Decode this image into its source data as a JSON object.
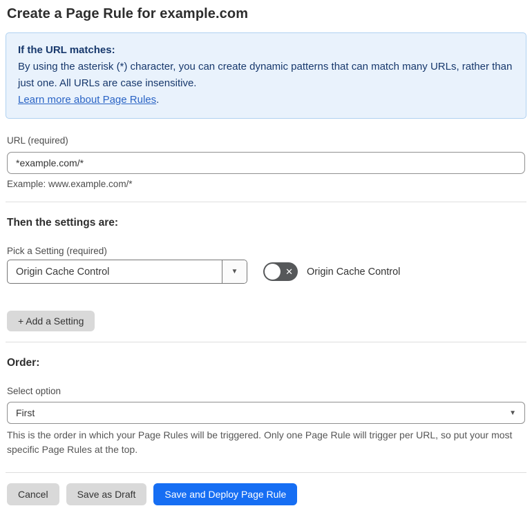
{
  "page": {
    "title": "Create a Page Rule for example.com"
  },
  "info_box": {
    "heading": "If the URL matches:",
    "body": "By using the asterisk (*) character, you can create dynamic patterns that can match many URLs, rather than just one. All URLs are case insensitive.",
    "link_text": "Learn more about Page Rules",
    "link_suffix": "."
  },
  "url_field": {
    "label": "URL (required)",
    "value": "*example.com/*",
    "helper": "Example: www.example.com/*"
  },
  "settings": {
    "heading": "Then the settings are:",
    "pick_label": "Pick a Setting (required)",
    "selected_setting": "Origin Cache Control",
    "toggle_label": "Origin Cache Control",
    "toggle_state": "off",
    "add_button_label": "+ Add a Setting"
  },
  "order": {
    "heading": "Order:",
    "label": "Select option",
    "selected_option": "First",
    "helper": "This is the order in which your Page Rules will be triggered. Only one Page Rule will trigger per URL, so put your most specific Page Rules at the top."
  },
  "footer": {
    "cancel_label": "Cancel",
    "save_draft_label": "Save as Draft",
    "save_deploy_label": "Save and Deploy Page Rule"
  },
  "icons": {
    "dropdown_caret": "▼",
    "select_caret": "▼",
    "toggle_off_x": "✕"
  },
  "colors": {
    "accent_blue": "#166ef3",
    "info_bg": "#e9f2fc",
    "info_border": "#afd1f1",
    "info_text": "#17386c",
    "link_blue": "#2a64c5",
    "toggle_off_bg": "#56585a",
    "button_gray": "#d9d9d9"
  }
}
